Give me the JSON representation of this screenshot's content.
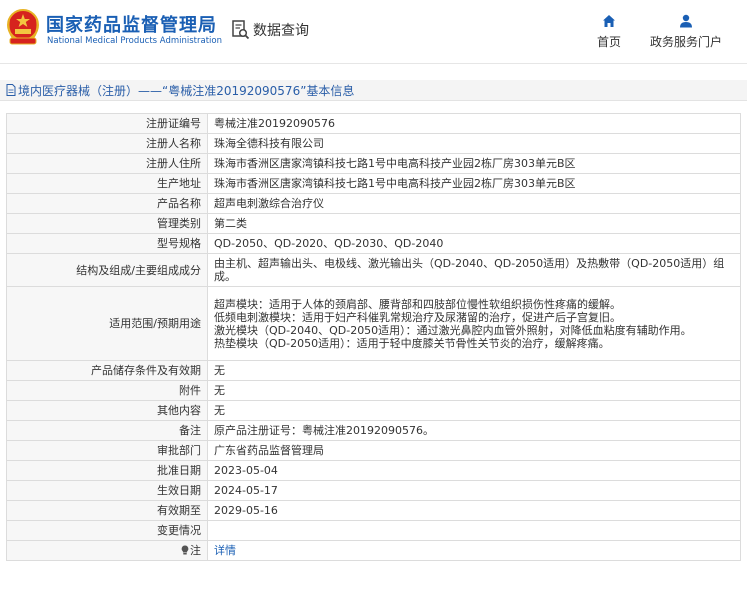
{
  "header": {
    "brand_cn": "国家药品监督管理局",
    "brand_en": "National Medical Products Administration",
    "query_label": "数据查询",
    "nav_home": "首页",
    "nav_portal": "政务服务门户",
    "emblem_icon": "national-emblem-icon",
    "accent_color": "#1a5fb4"
  },
  "breadcrumb": {
    "text": "境内医疗器械（注册）——“粤械注准20192090576”基本信息"
  },
  "rows": [
    {
      "label": "注册证编号",
      "value": "粤械注准20192090576"
    },
    {
      "label": "注册人名称",
      "value": "珠海全德科技有限公司"
    },
    {
      "label": "注册人住所",
      "value": "珠海市香洲区唐家湾镇科技七路1号中电高科技产业园2栋厂房303单元B区"
    },
    {
      "label": "生产地址",
      "value": "珠海市香洲区唐家湾镇科技七路1号中电高科技产业园2栋厂房303单元B区"
    },
    {
      "label": "产品名称",
      "value": "超声电刺激综合治疗仪"
    },
    {
      "label": "管理类别",
      "value": "第二类"
    },
    {
      "label": "型号规格",
      "value": "QD-2050、QD-2020、QD-2030、QD-2040"
    },
    {
      "label": "结构及组成/主要组成成分",
      "value": "由主机、超声输出头、电极线、激光输出头（QD-2040、QD-2050适用）及热敷带（QD-2050适用）组成。"
    },
    {
      "label": "适用范围/预期用途",
      "lines": [
        "超声模块：适用于人体的颈肩部、腰背部和四肢部位慢性软组织损伤性疼痛的缓解。",
        "低频电刺激模块：适用于妇产科催乳常规治疗及尿潴留的治疗，促进产后子宫复旧。",
        "激光模块（QD-2040、QD-2050适用）：通过激光鼻腔内血管外照射，对降低血粘度有辅助作用。",
        "热垫模块（QD-2050适用）：适用于轻中度膝关节骨性关节炎的治疗，缓解疼痛。"
      ]
    },
    {
      "label": "产品储存条件及有效期",
      "value": "无"
    },
    {
      "label": "附件",
      "value": "无"
    },
    {
      "label": "其他内容",
      "value": "无"
    },
    {
      "label": "备注",
      "value": "原产品注册证号：粤械注准20192090576。"
    },
    {
      "label": "审批部门",
      "value": "广东省药品监督管理局"
    },
    {
      "label": "批准日期",
      "value": "2023-05-04"
    },
    {
      "label": "生效日期",
      "value": "2024-05-17"
    },
    {
      "label": "有效期至",
      "value": "2029-05-16"
    },
    {
      "label": "变更情况",
      "value": ""
    },
    {
      "label": "注",
      "value": "详情",
      "icon": "lightbulb-icon"
    }
  ]
}
